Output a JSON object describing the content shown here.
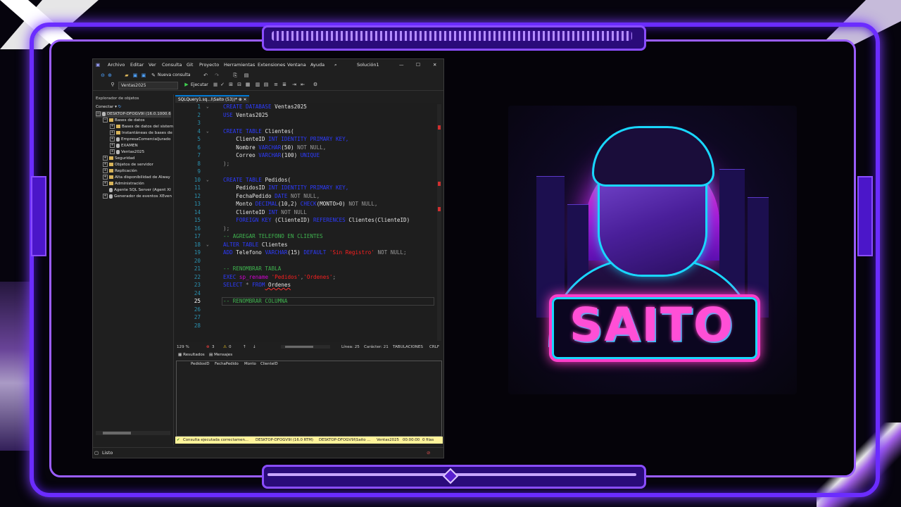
{
  "menu": [
    "Archivo",
    "Editar",
    "Ver",
    "Consulta",
    "Git",
    "Proyecto",
    "Herramientas",
    "Extensiones",
    "Ventana",
    "Ayuda"
  ],
  "solution": "Solución1",
  "toolbar": {
    "new_query": "Nueva consulta",
    "database": "Ventas2025",
    "execute": "Ejecutar"
  },
  "explorer": {
    "title": "Explorador de objetos",
    "connect": "Conectar",
    "server": "DESKTOP-DFOGV9I (16.0.1000.6",
    "items": [
      "Bases de datos",
      "Bases de datos del sistem",
      "Instantáneas de bases de",
      "EmpresaComercialJurado",
      "EXAMEN",
      "Ventas2025",
      "Seguridad",
      "Objetos de servidor",
      "Replicación",
      "Alta disponibilidad de Alway",
      "Administración",
      "Agente SQL Server (Agent XI",
      "Generador de eventos XEven"
    ]
  },
  "tab_label": "SQLQuery1.sq...I\\Saito (53))*",
  "code": {
    "l1": {
      "a": "CREATE DATABASE",
      "b": " Ventas2025"
    },
    "l2": {
      "a": "USE",
      "b": " Ventas2025"
    },
    "l4": {
      "a": "CREATE TABLE",
      "b": " Clientes("
    },
    "l5": {
      "a": "    ClienteID",
      "b": " INT IDENTITY PRIMARY KEY,"
    },
    "l6": {
      "a": "    Nombre",
      "b": " VARCHAR",
      "c": "(50)",
      "d": " NOT NULL,"
    },
    "l7": {
      "a": "    Correo",
      "b": " VARCHAR",
      "c": "(100)",
      "d": " UNIQUE"
    },
    "l8": ");",
    "l10": {
      "a": "CREATE TABLE",
      "b": " Pedidos("
    },
    "l11": {
      "a": "    PedidosID",
      "b": " INT IDENTITY PRIMARY KEY,"
    },
    "l12": {
      "a": "    FechaPedido",
      "b": " DATE",
      "c": " NOT NULL,"
    },
    "l13": {
      "a": "    Monto",
      "b": " DECIMAL",
      "c": "(10,2)",
      "d": " CHECK",
      "e": "(MONTO>0)",
      "f": " NOT NULL,"
    },
    "l14": {
      "a": "    ClienteID",
      "b": " INT",
      "c": " NOT NULL"
    },
    "l15": {
      "a": "    FOREIGN KEY",
      "b": " (ClienteID)",
      "c": " REFERENCES",
      "d": " Clientes(ClienteID)"
    },
    "l16": ");",
    "l17": "-- AGREGAR TELEFONO EN CLIENTES",
    "l18": {
      "a": "ALTER TABLE",
      "b": " Clientes"
    },
    "l19": {
      "a": "ADD",
      "b": " Telefono",
      "c": " VARCHAR",
      "d": "(15)",
      "e": " DEFAULT",
      "f": " 'Sin Registro'",
      "g": " NOT NULL;"
    },
    "l21": "-- RENOMBRAR TABLA",
    "l22": {
      "a": "EXEC",
      "b": " sp_rename",
      "c": " 'Pedidos'",
      "d": ",",
      "e": "'Ordenes'",
      "f": ";"
    },
    "l23": {
      "a": "SELECT",
      "b": " * ",
      "c": "FROM",
      "d": " Ordenes"
    },
    "l25": "-- RENOMBRAR COLUMNA"
  },
  "editor_status": {
    "zoom": "129 %",
    "errors": "3",
    "warnings": "0",
    "line": "Línea: 25",
    "char": "Carácter: 21",
    "tabs": "TABULACIONES",
    "eol": "CRLF"
  },
  "results": {
    "tab_results": "Resultados",
    "tab_messages": "Mensajes",
    "columns": [
      "PedidosID",
      "FechaPedido",
      "Monto",
      "ClienteID"
    ]
  },
  "exec_bar": {
    "message": "Consulta ejecutada correctamen...",
    "server": "DESKTOP-DFOGV9I (16.0 RTM)",
    "user": "DESKTOP-DFOGV9I\\Saito ...",
    "db": "Ventas2025",
    "time": "00:00:00",
    "rows": "0 filas"
  },
  "status": "Listo",
  "logo": {
    "text": "SAITO",
    "colors": {
      "magenta": "#ff3ec9",
      "cyan": "#19d7ff",
      "purple": "#6b2cff"
    }
  }
}
